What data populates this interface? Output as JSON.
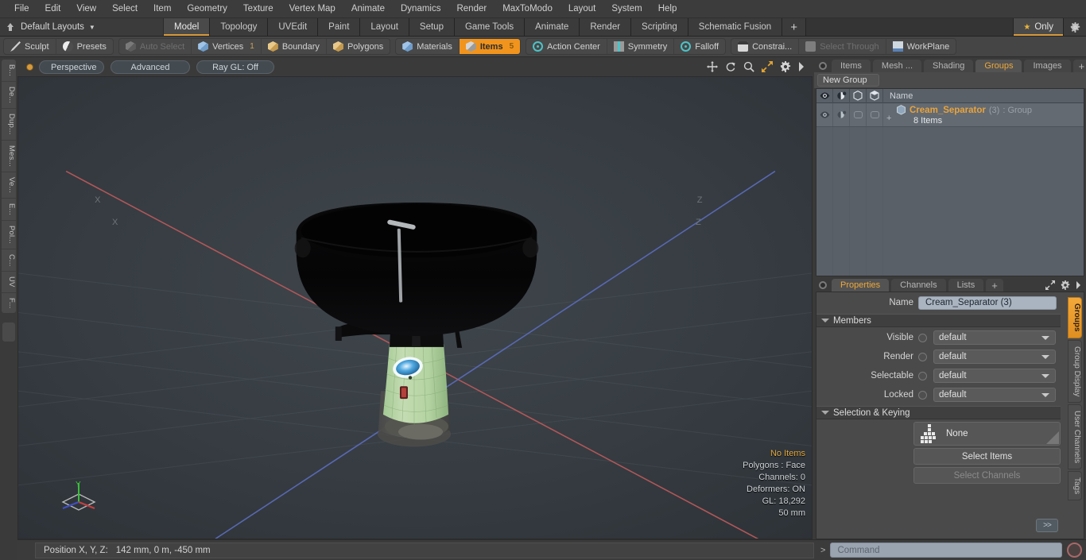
{
  "menubar": {
    "items": [
      "File",
      "Edit",
      "View",
      "Select",
      "Item",
      "Geometry",
      "Texture",
      "Vertex Map",
      "Animate",
      "Dynamics",
      "Render",
      "MaxToModo",
      "Layout",
      "System",
      "Help"
    ]
  },
  "layout_tabs": {
    "selector_label": "Default Layouts",
    "tabs": [
      "Model",
      "Topology",
      "UVEdit",
      "Paint",
      "Layout",
      "Setup",
      "Game Tools",
      "Animate",
      "Render",
      "Scripting",
      "Schematic Fusion"
    ],
    "active": "Model",
    "add_label": "+",
    "only_label": "Only",
    "gear_icon": "gear-icon",
    "star_icon": "star-icon"
  },
  "modebar": {
    "left_group": [
      {
        "label": "Sculpt",
        "icon": "pencil-icon",
        "state": "normal"
      },
      {
        "label": "Presets",
        "icon": "sphere-icon",
        "state": "normal"
      }
    ],
    "select_group": [
      {
        "label": "Auto Select",
        "icon": "cube-icon",
        "state": "disabled",
        "count": ""
      },
      {
        "label": "Vertices",
        "icon": "cube-blue-icon",
        "state": "normal",
        "count": "1"
      },
      {
        "label": "Boundary",
        "icon": "cube-gold-icon",
        "state": "normal",
        "count": ""
      },
      {
        "label": "Polygons",
        "icon": "cube-gold-icon",
        "state": "normal",
        "count": ""
      }
    ],
    "items_group": [
      {
        "label": "Materials",
        "icon": "cube-blue-icon",
        "state": "normal",
        "count": ""
      },
      {
        "label": "Items",
        "icon": "cube-icon",
        "state": "active",
        "count": "5"
      }
    ],
    "tool_group": [
      {
        "label": "Action Center",
        "icon": "target-icon",
        "state": "normal"
      },
      {
        "label": "Symmetry",
        "icon": "symmetry-icon",
        "state": "normal"
      },
      {
        "label": "Falloff",
        "icon": "falloff-icon",
        "state": "normal"
      }
    ],
    "constraint_group": [
      {
        "label": "Constrai...",
        "icon": "rect-icon",
        "state": "normal"
      },
      {
        "label": "Select Through",
        "icon": "people-icon",
        "state": "disabled"
      },
      {
        "label": "WorkPlane",
        "icon": "workplane-icon",
        "state": "normal"
      }
    ]
  },
  "left_rail": {
    "tabs": [
      "B...",
      "De...",
      "Dup...",
      "Mes...",
      "Ve...",
      "E...",
      "Pol...",
      "C...",
      "UV",
      "F..."
    ]
  },
  "viewport": {
    "view_mode": "Perspective",
    "shading": "Advanced",
    "raygl": "Ray GL: Off",
    "header_icons": [
      "move-icon",
      "rotate-icon",
      "zoom-icon",
      "fit-icon",
      "gear-icon",
      "chevron-right-icon"
    ],
    "axis_label_x": "X",
    "axis_label_z": "Z",
    "gizmo_axis": "Y",
    "stats": {
      "selection": "No Items",
      "polygons": "Polygons : Face",
      "channels": "Channels: 0",
      "deformers": "Deformers: ON",
      "gl": "GL: 18,292",
      "grid": "50 mm"
    }
  },
  "statusbar": {
    "position_label": "Position X, Y, Z:",
    "position_value": "142 mm, 0 m, -450 mm"
  },
  "right_panel": {
    "tabs": [
      "Items",
      "Mesh ...",
      "Shading",
      "Groups",
      "Images"
    ],
    "active_tab": "Groups",
    "add_label": "+",
    "panel_icons": [
      "expand-icon",
      "gear-icon",
      "chevron-right-icon"
    ],
    "new_group_button": "New Group",
    "group_list": {
      "columns": [
        "eye-icon",
        "render-icon",
        "cube-outline-icon",
        "cube-shaded-icon"
      ],
      "name_header": "Name",
      "rows": [
        {
          "expander": "+",
          "name": "Cream_Separator",
          "count": "(3)",
          "type": ": Group",
          "subtitle": "8 Items"
        }
      ]
    }
  },
  "properties": {
    "tabs": [
      "Properties",
      "Channels",
      "Lists"
    ],
    "active_tab": "Properties",
    "add_label": "+",
    "panel_icons": [
      "expand-icon",
      "gear-icon",
      "chevron-right-icon"
    ],
    "name_label": "Name",
    "name_value": "Cream_Separator (3)",
    "members_section": "Members",
    "members_rows": [
      {
        "label": "Visible",
        "value": "default"
      },
      {
        "label": "Render",
        "value": "default"
      },
      {
        "label": "Selectable",
        "value": "default"
      },
      {
        "label": "Locked",
        "value": "default"
      }
    ],
    "selection_section": "Selection & Keying",
    "selection_none": "None",
    "select_items_button": "Select Items",
    "select_channels_button": "Select Channels",
    "more_button": ">>",
    "side_tabs": [
      "Groups",
      "Group Display",
      "User Channels",
      "Tags"
    ],
    "side_tab_active": "Groups"
  },
  "command_bar": {
    "prompt": ">",
    "placeholder": "Command",
    "record_icon": "record-icon"
  },
  "colors": {
    "accent_orange": "#f0941e",
    "tab_underline": "#d79a3c",
    "group_name": "#e8a33c",
    "stats_highlight": "#e2a93f",
    "axis_x": "#b25a5a",
    "axis_z": "#5a6fb2",
    "axis_y": "#4aa84a",
    "field_blue": "#aab4c0"
  }
}
